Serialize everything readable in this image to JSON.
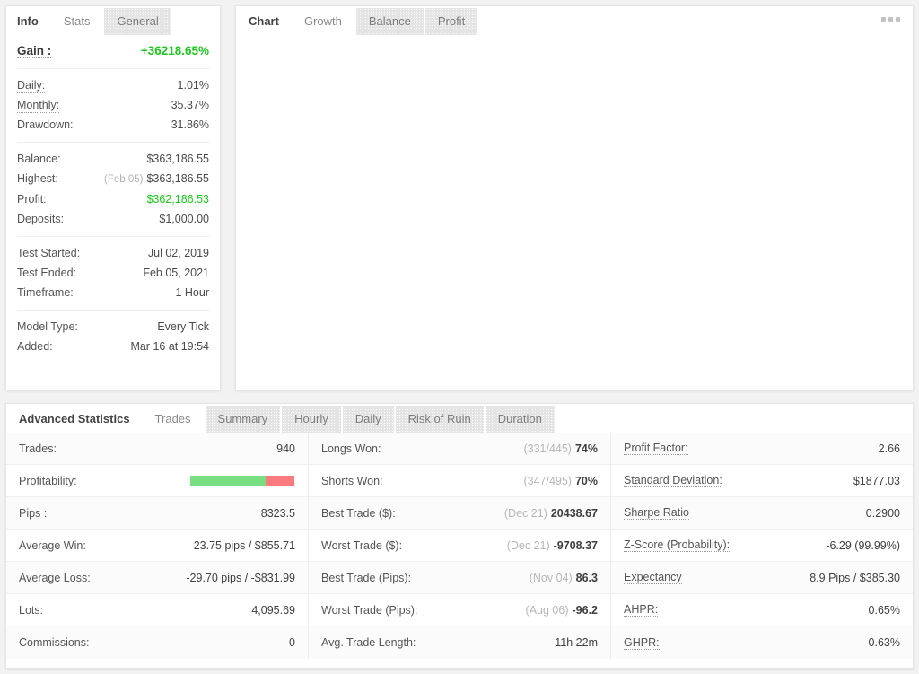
{
  "left_panel": {
    "header_label": "Info",
    "tabs": [
      {
        "label": "Stats",
        "active": true
      },
      {
        "label": "General",
        "active": false
      }
    ],
    "groups": [
      {
        "rows": [
          {
            "label": "Gain :",
            "value": "+36218.65%",
            "dotted": true,
            "style": "gain"
          }
        ]
      },
      {
        "rows": [
          {
            "label": "Daily:",
            "value": "1.01%",
            "dotted": true
          },
          {
            "label": "Monthly:",
            "value": "35.37%",
            "dotted": true
          },
          {
            "label": "Drawdown:",
            "value": "31.86%",
            "dotted": false
          }
        ]
      },
      {
        "rows": [
          {
            "label": "Balance:",
            "value": "$363,186.55",
            "dotted": false
          },
          {
            "label": "Highest:",
            "sub": "(Feb 05)",
            "value": "$363,186.55",
            "dotted": false
          },
          {
            "label": "Profit:",
            "value": "$362,186.53",
            "dotted": false,
            "green": true
          },
          {
            "label": "Deposits:",
            "value": "$1,000.00",
            "dotted": false
          }
        ]
      },
      {
        "rows": [
          {
            "label": "Test Started:",
            "value": "Jul 02, 2019",
            "dotted": false
          },
          {
            "label": "Test Ended:",
            "value": "Feb 05, 2021",
            "dotted": false
          },
          {
            "label": "Timeframe:",
            "value": "1 Hour",
            "dotted": false
          }
        ]
      },
      {
        "rows": [
          {
            "label": "Model Type:",
            "value": "Every Tick",
            "dotted": false
          },
          {
            "label": "Added:",
            "value": "Mar 16 at 19:54",
            "dotted": false
          }
        ]
      }
    ]
  },
  "chart_panel": {
    "header_label": "Chart",
    "tabs": [
      {
        "label": "Growth",
        "active": true
      },
      {
        "label": "Balance",
        "active": false
      },
      {
        "label": "Profit",
        "active": false
      }
    ],
    "menu_icon": "more-options-icon"
  },
  "bottom_panel": {
    "header_label": "Advanced Statistics",
    "tabs": [
      {
        "label": "Trades",
        "active": true
      },
      {
        "label": "Summary",
        "active": false
      },
      {
        "label": "Hourly",
        "active": false
      },
      {
        "label": "Daily",
        "active": false
      },
      {
        "label": "Risk of Ruin",
        "active": false
      },
      {
        "label": "Duration",
        "active": false
      }
    ],
    "columns": [
      {
        "rows": [
          {
            "key": "Trades:",
            "value": "940",
            "dotted": false
          },
          {
            "key": "Profitability:",
            "type": "bar",
            "win_pct": 72,
            "lose_pct": 28,
            "dotted": false
          },
          {
            "key": "Pips :",
            "value": "8323.5",
            "dotted": false
          },
          {
            "key": "Average Win:",
            "value": "23.75 pips / $855.71",
            "dotted": false
          },
          {
            "key": "Average Loss:",
            "value": "-29.70 pips / -$831.99",
            "dotted": false
          },
          {
            "key": "Lots:",
            "value": "4,095.69",
            "dotted": false
          },
          {
            "key": "Commissions:",
            "value": "0",
            "dotted": false
          }
        ]
      },
      {
        "rows": [
          {
            "key": "Longs Won:",
            "pre": "(331/445)",
            "value": "74%",
            "bold": true,
            "dotted": false
          },
          {
            "key": "Shorts Won:",
            "pre": "(347/495)",
            "value": "70%",
            "bold": true,
            "dotted": false
          },
          {
            "key": "Best Trade ($):",
            "pre": "(Dec 21)",
            "value": "20438.67",
            "bold": true,
            "dotted": false
          },
          {
            "key": "Worst Trade ($):",
            "pre": "(Dec 21)",
            "value": "-9708.37",
            "bold": true,
            "dotted": false
          },
          {
            "key": "Best Trade (Pips):",
            "pre": "(Nov 04)",
            "value": "86.3",
            "bold": true,
            "dotted": false
          },
          {
            "key": "Worst Trade (Pips):",
            "pre": "(Aug 06)",
            "value": "-96.2",
            "bold": true,
            "dotted": false
          },
          {
            "key": "Avg. Trade Length:",
            "value": "11h 22m",
            "dotted": false
          }
        ]
      },
      {
        "rows": [
          {
            "key": "Profit Factor:",
            "value": "2.66",
            "dotted": true
          },
          {
            "key": "Standard Deviation:",
            "value": "$1877.03",
            "dotted": true
          },
          {
            "key": "Sharpe Ratio",
            "value": "0.2900",
            "dotted": true
          },
          {
            "key": "Z-Score (Probability):",
            "value": "-6.29 (99.99%)",
            "dotted": true
          },
          {
            "key": "Expectancy",
            "value": "8.9 Pips / $385.30",
            "dotted": true
          },
          {
            "key": "AHPR:",
            "value": "0.65%",
            "dotted": true
          },
          {
            "key": "GHPR:",
            "value": "0.63%",
            "dotted": true
          }
        ]
      }
    ]
  },
  "colors": {
    "gain_green": "#1ec81e",
    "profit_green": "#1ec81e",
    "bar_win": "#79dd81",
    "bar_lose": "#fb7a7e",
    "page_bg": "#f2f2f2"
  }
}
